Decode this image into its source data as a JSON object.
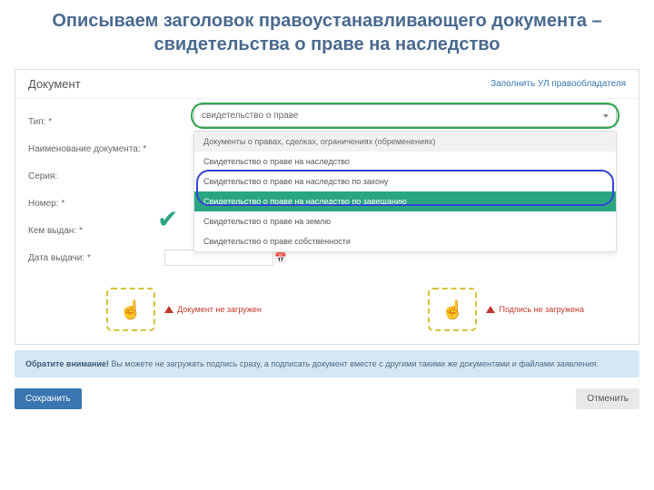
{
  "title": "Описываем заголовок правоустанавливающего документа – свидетельства о праве на наследство",
  "panel": {
    "header": "Документ",
    "header_link": "Заполнить УЛ правообладателя"
  },
  "labels": {
    "type": "Тип: *",
    "doc_name": "Наименование документа: *",
    "series": "Серия:",
    "number": "Номер: *",
    "issued_by": "Кем выдан: *",
    "issue_date": "Дата выдачи: *"
  },
  "combo": {
    "value": "свидетельство о праве",
    "group": "Документы о правах, сделках, ограничениях (обременениях)",
    "options": [
      "Свидетельство о праве на наследство",
      "Свидетельство о праве на наследство по закону",
      "Свидетельство о праве на наследство по завещанию",
      "Свидетельство о праве на землю",
      "Свидетельство о праве собственности"
    ],
    "selected_index": 2
  },
  "upload": {
    "doc_warn": "Документ не загружен",
    "sign_warn": "Подпись не загружена",
    "pointer": "☝"
  },
  "notice": {
    "bold": "Обратите внимание!",
    "text": " Вы можете не загружать подпись сразу, а подписать документ вместе с другими такими же документами и файлами заявления."
  },
  "buttons": {
    "save": "Сохранить",
    "cancel": "Отменить"
  }
}
